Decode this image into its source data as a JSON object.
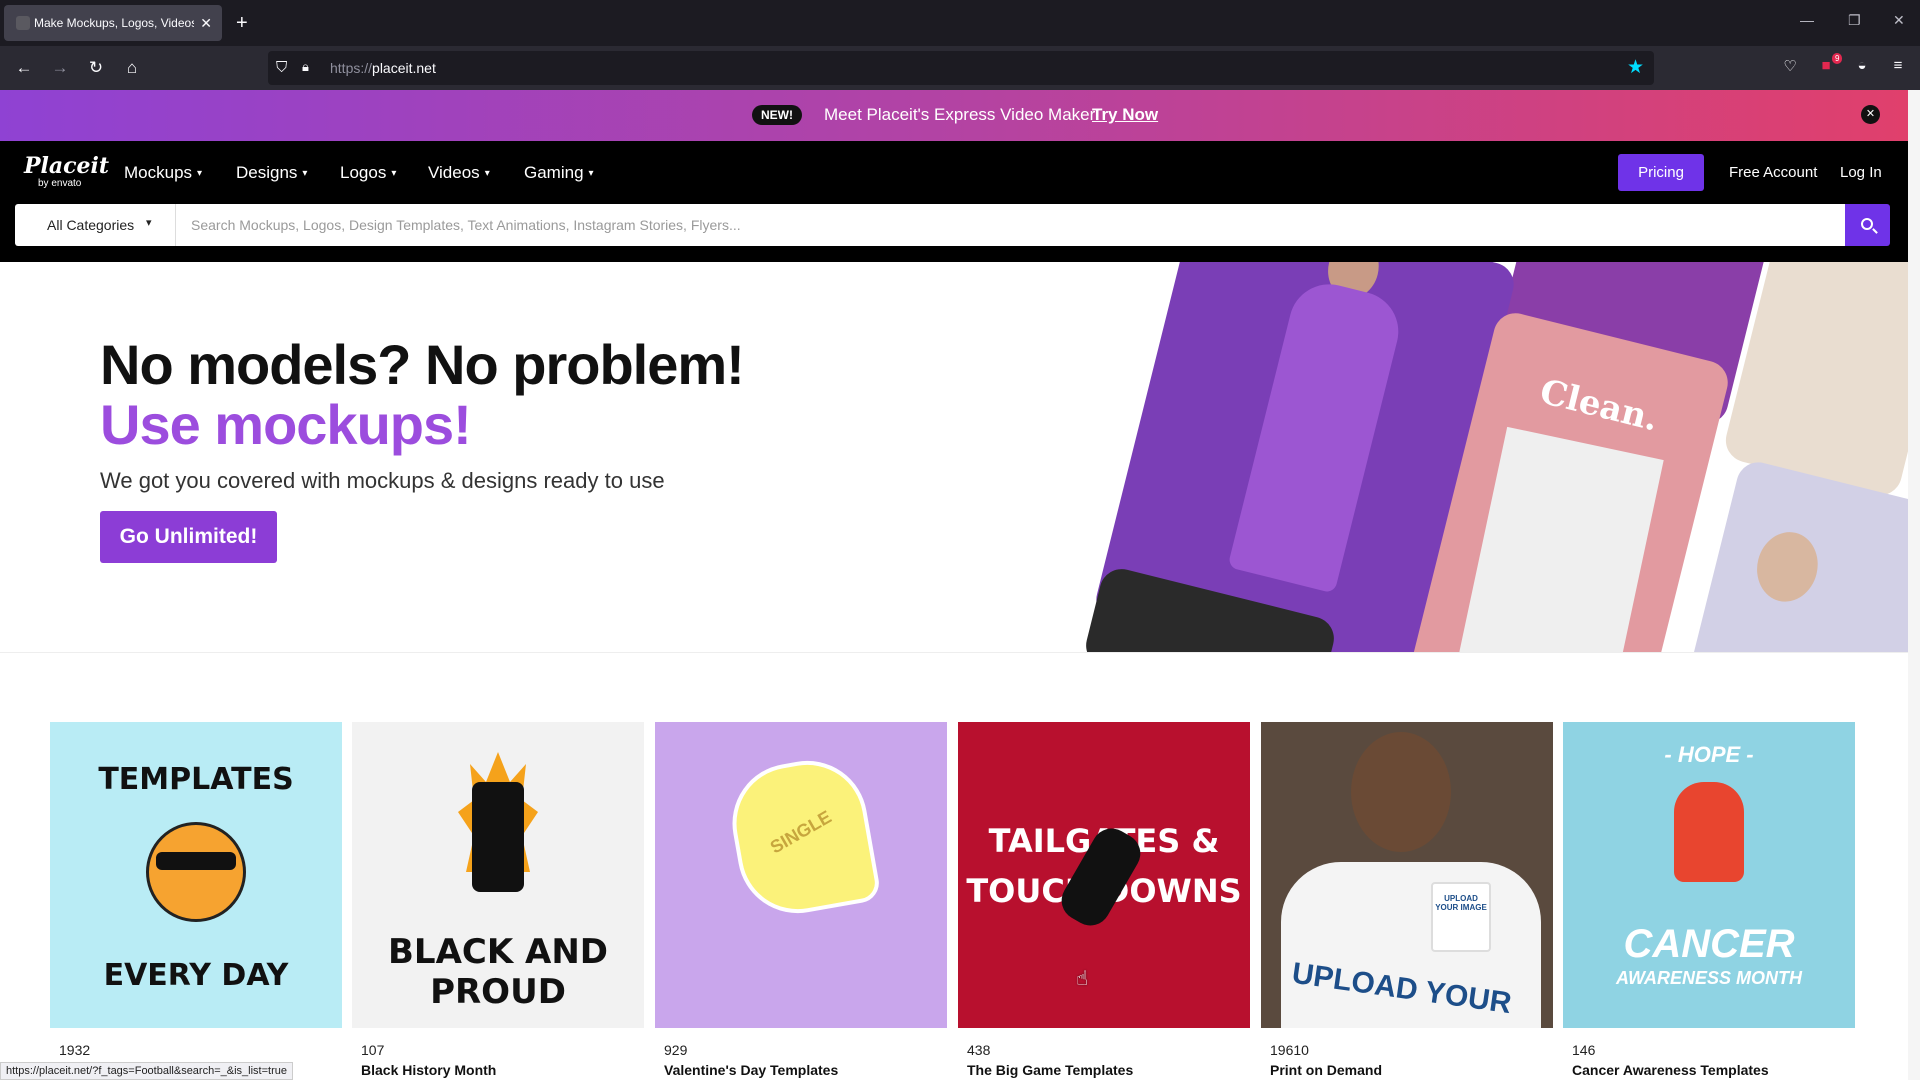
{
  "browser": {
    "tab_title": "Make Mockups, Logos, Videos",
    "url_prefix": "https://",
    "url_host": "placeit.net",
    "notification_count": "9"
  },
  "promo": {
    "badge": "NEW!",
    "message": "Meet Placeit's Express Video Maker!",
    "cta": "Try Now"
  },
  "nav": {
    "logo_main": "Placeit",
    "logo_sub": "by envato",
    "menu": [
      "Mockups",
      "Designs",
      "Logos",
      "Videos",
      "Gaming"
    ],
    "pricing": "Pricing",
    "free_account": "Free Account",
    "login": "Log In"
  },
  "search": {
    "category": "All Categories",
    "placeholder": "Search Mockups, Logos, Design Templates, Text Animations, Instagram Stories, Flyers..."
  },
  "hero": {
    "line1": "No models? No problem!",
    "line2": "Use mockups!",
    "subtitle": "We got you covered with mockups & designs ready to use",
    "cta": "Go Unlimited!",
    "collage_text_clean": "Clean."
  },
  "categories": [
    {
      "count": "1932",
      "name": "",
      "art_top": "TEMPLATES",
      "art_bottom": "EVERY DAY",
      "bg": "#b9ecf5"
    },
    {
      "count": "107",
      "name": "Black History Month",
      "art_top": "BLACK AND",
      "art_bottom": "PROUD",
      "bg": "#f2f2f2"
    },
    {
      "count": "929",
      "name": "Valentine's Day Templates",
      "art_top": "SINGLE",
      "art_bottom": "",
      "bg": "#c9a6ec"
    },
    {
      "count": "438",
      "name": "The Big Game Templates",
      "art_top": "TAILGATES &",
      "art_bottom": "TOUCH DOWNS",
      "bg": "#b8102e"
    },
    {
      "count": "19610",
      "name": "Print on Demand",
      "art_top": "UPLOAD YOUR IMAGE",
      "art_bottom": "UPLOAD YOUR",
      "bg": "#5a4a3e"
    },
    {
      "count": "146",
      "name": "Cancer Awareness Templates",
      "art_top": "- HOPE -",
      "art_bottom": "CANCER",
      "art_sub": "AWARENESS MONTH",
      "bg": "#8fd3e3"
    }
  ],
  "status_url": "https://placeit.net/?f_tags=Football&search=_&is_list=true",
  "colors": {
    "accent": "#6f33e8",
    "hero_purple": "#9c4dde",
    "cta_purple": "#8c3dd6"
  }
}
